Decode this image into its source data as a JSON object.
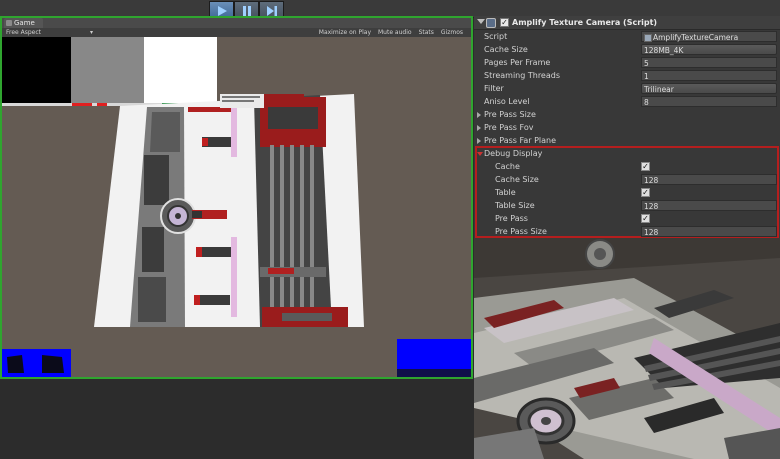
{
  "toolbar": {
    "play_icon": "play-icon",
    "pause_icon": "pause-icon",
    "step_icon": "step-icon"
  },
  "game_view": {
    "tab_label": "Game",
    "aspect": "Free Aspect",
    "options": [
      "Maximize on Play",
      "Mute audio",
      "Stats",
      "Gizmos"
    ]
  },
  "inspector": {
    "component_title": "Amplify Texture Camera (Script)",
    "fields": [
      {
        "label": "Script",
        "value": "AmplifyTextureCamera",
        "kind": "object"
      },
      {
        "label": "Cache Size",
        "value": "128MB_4K",
        "kind": "dropdown"
      },
      {
        "label": "Pages Per Frame",
        "value": "5",
        "kind": "number"
      },
      {
        "label": "Streaming Threads",
        "value": "1",
        "kind": "number"
      },
      {
        "label": "Filter",
        "value": "Trilinear",
        "kind": "dropdown"
      },
      {
        "label": "Aniso Level",
        "value": "8",
        "kind": "number"
      }
    ],
    "foldouts": [
      "Pre Pass Size",
      "Pre Pass Fov",
      "Pre Pass Far Plane"
    ],
    "debug": {
      "label": "Debug Display",
      "rows": [
        {
          "label": "Cache",
          "checked": true
        },
        {
          "label": "Cache Size",
          "value": "128"
        },
        {
          "label": "Table",
          "checked": true
        },
        {
          "label": "Table Size",
          "value": "128"
        },
        {
          "label": "Pre Pass",
          "checked": true
        },
        {
          "label": "Pre Pass Size",
          "value": "128"
        }
      ],
      "check_glyph": "✓"
    }
  },
  "colors": {
    "game_border": "#2fa52f",
    "debug_border": "#b51e1e",
    "play_active": "#3d6796",
    "debug_blue": "#0000ff"
  }
}
